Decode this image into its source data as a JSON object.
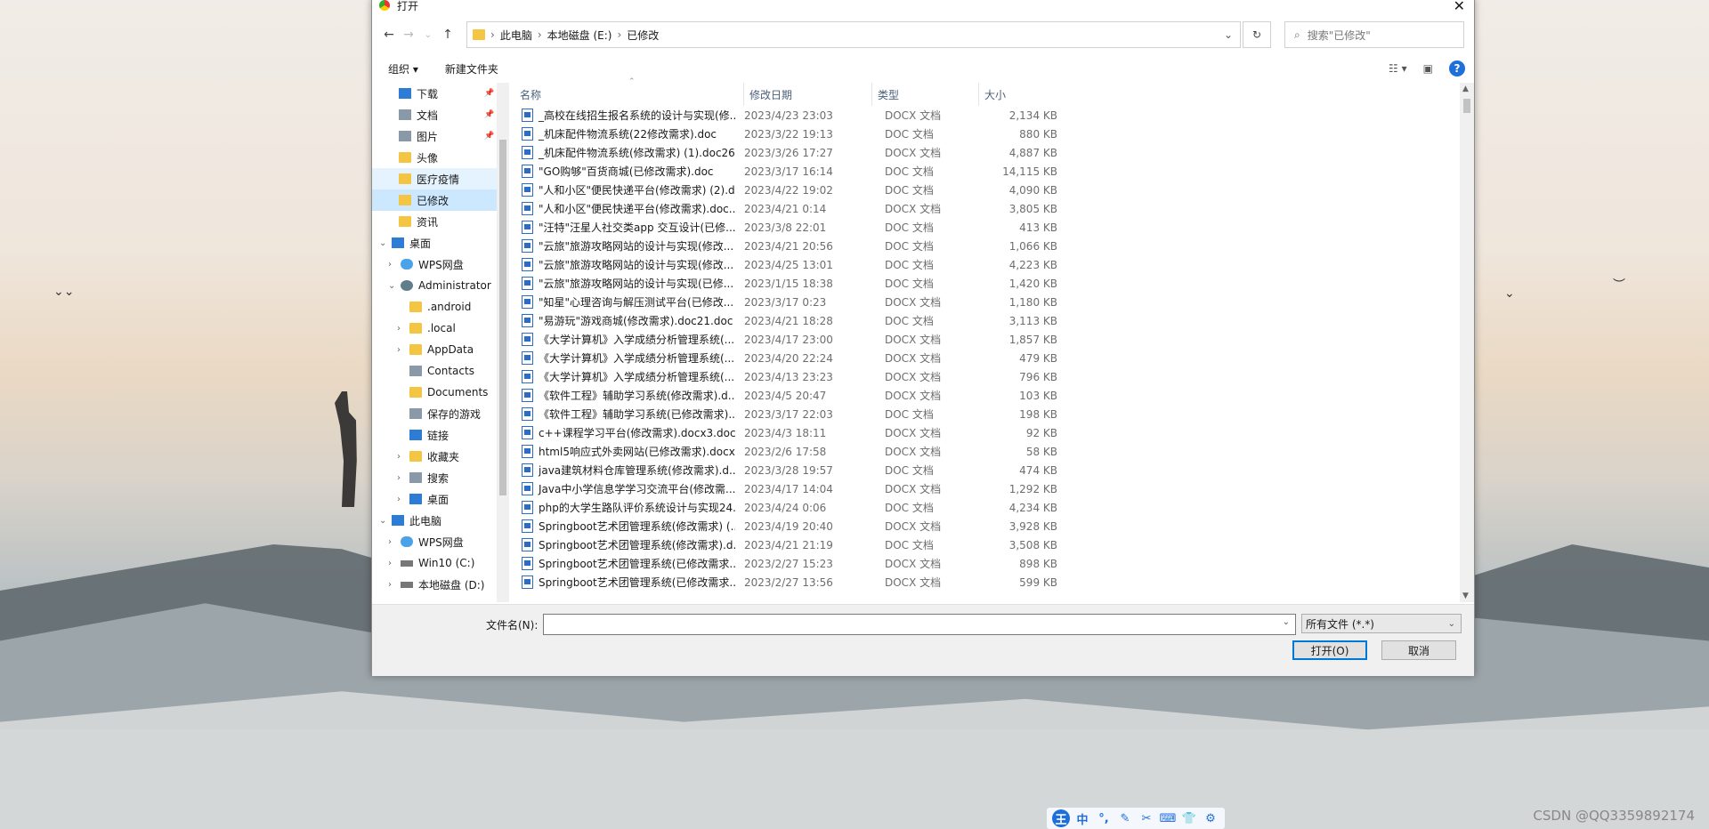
{
  "window": {
    "title": "打开"
  },
  "address": {
    "crumbs": [
      "此电脑",
      "本地磁盘 (E:)",
      "已修改"
    ],
    "search_placeholder": "搜索\"已修改\""
  },
  "toolbar": {
    "organize": "组织 ▾",
    "new_folder": "新建文件夹"
  },
  "nav": {
    "quick": [
      {
        "label": "下载",
        "icon": "download-icon",
        "pinned": true
      },
      {
        "label": "文档",
        "icon": "document-icon",
        "pinned": true
      },
      {
        "label": "图片",
        "icon": "picture-icon",
        "pinned": true
      },
      {
        "label": "头像",
        "icon": "folder-icon"
      },
      {
        "label": "医疗疫情",
        "icon": "folder-icon"
      },
      {
        "label": "已修改",
        "icon": "folder-icon"
      },
      {
        "label": "资讯",
        "icon": "folder-icon"
      }
    ],
    "desktop": "桌面",
    "wps_cloud": "WPS网盘",
    "admin": "Administrator",
    "admin_children": [
      ".android",
      ".local",
      "AppData",
      "Contacts",
      "Documents",
      "保存的游戏",
      "链接",
      "收藏夹",
      "搜索",
      "桌面"
    ],
    "this_pc": "此电脑",
    "pc_children": [
      "WPS网盘",
      "Win10 (C:)",
      "本地磁盘 (D:)"
    ]
  },
  "columns": {
    "name": "名称",
    "date": "修改日期",
    "type": "类型",
    "size": "大小"
  },
  "files": [
    {
      "name": "_高校在线招生报名系统的设计与实现(修...",
      "date": "2023/4/23 23:03",
      "type": "DOCX 文档",
      "size": "2,134 KB"
    },
    {
      "name": "_机床配件物流系统(22修改需求).doc",
      "date": "2023/3/22 19:13",
      "type": "DOC 文档",
      "size": "880 KB"
    },
    {
      "name": "_机床配件物流系统(修改需求) (1).doc26...",
      "date": "2023/3/26 17:27",
      "type": "DOCX 文档",
      "size": "4,887 KB"
    },
    {
      "name": "\"GO购够\"百货商城(已修改需求).doc",
      "date": "2023/3/17 16:14",
      "type": "DOC 文档",
      "size": "14,115 KB"
    },
    {
      "name": "\"人和小区\"便民快递平台(修改需求) (2).d...",
      "date": "2023/4/22 19:02",
      "type": "DOC 文档",
      "size": "4,090 KB"
    },
    {
      "name": "\"人和小区\"便民快递平台(修改需求).doc...",
      "date": "2023/4/21 0:14",
      "type": "DOCX 文档",
      "size": "3,805 KB"
    },
    {
      "name": "\"汪特\"汪星人社交类app 交互设计(已修...",
      "date": "2023/3/8 22:01",
      "type": "DOC 文档",
      "size": "413 KB"
    },
    {
      "name": "\"云旅\"旅游攻略网站的设计与实现(修改...",
      "date": "2023/4/21 20:56",
      "type": "DOC 文档",
      "size": "1,066 KB"
    },
    {
      "name": "\"云旅\"旅游攻略网站的设计与实现(修改...",
      "date": "2023/4/25 13:01",
      "type": "DOC 文档",
      "size": "4,223 KB"
    },
    {
      "name": "\"云旅\"旅游攻略网站的设计与实现(已修...",
      "date": "2023/1/15 18:38",
      "type": "DOC 文档",
      "size": "1,420 KB"
    },
    {
      "name": "\"知星\"心理咨询与解压测试平台(已修改...",
      "date": "2023/3/17 0:23",
      "type": "DOCX 文档",
      "size": "1,180 KB"
    },
    {
      "name": "\"易游玩\"游戏商城(修改需求).doc21.doc",
      "date": "2023/4/21 18:28",
      "type": "DOC 文档",
      "size": "3,113 KB"
    },
    {
      "name": "《大学计算机》入学成绩分析管理系统(...",
      "date": "2023/4/17 23:00",
      "type": "DOCX 文档",
      "size": "1,857 KB"
    },
    {
      "name": "《大学计算机》入学成绩分析管理系统(...",
      "date": "2023/4/20 22:24",
      "type": "DOCX 文档",
      "size": "479 KB"
    },
    {
      "name": "《大学计算机》入学成绩分析管理系统(...",
      "date": "2023/4/13 23:23",
      "type": "DOCX 文档",
      "size": "796 KB"
    },
    {
      "name": "《软件工程》辅助学习系统(修改需求).d...",
      "date": "2023/4/5 20:47",
      "type": "DOCX 文档",
      "size": "103 KB"
    },
    {
      "name": "《软件工程》辅助学习系统(已修改需求)....",
      "date": "2023/3/17 22:03",
      "type": "DOC 文档",
      "size": "198 KB"
    },
    {
      "name": "c++课程学习平台(修改需求).docx3.docx",
      "date": "2023/4/3 18:11",
      "type": "DOCX 文档",
      "size": "92 KB"
    },
    {
      "name": "html5响应式外卖网站(已修改需求).docx",
      "date": "2023/2/6 17:58",
      "type": "DOCX 文档",
      "size": "58 KB"
    },
    {
      "name": "java建筑材料仓库管理系统(修改需求).d...",
      "date": "2023/3/28 19:57",
      "type": "DOC 文档",
      "size": "474 KB"
    },
    {
      "name": "Java中小学信息学学习交流平台(修改需...",
      "date": "2023/4/17 14:04",
      "type": "DOCX 文档",
      "size": "1,292 KB"
    },
    {
      "name": "php的大学生路队评价系统设计与实现24...",
      "date": "2023/4/24 0:06",
      "type": "DOC 文档",
      "size": "4,234 KB"
    },
    {
      "name": "Springboot艺术团管理系统(修改需求) (...",
      "date": "2023/4/19 20:40",
      "type": "DOCX 文档",
      "size": "3,928 KB"
    },
    {
      "name": "Springboot艺术团管理系统(修改需求).d...",
      "date": "2023/4/21 21:19",
      "type": "DOC 文档",
      "size": "3,508 KB"
    },
    {
      "name": "Springboot艺术团管理系统(已修改需求...",
      "date": "2023/2/27 15:23",
      "type": "DOCX 文档",
      "size": "898 KB"
    },
    {
      "name": "Springboot艺术团管理系统(已修改需求...",
      "date": "2023/2/27 13:56",
      "type": "DOCX 文档",
      "size": "599 KB"
    }
  ],
  "bottom": {
    "filename_label": "文件名(N):",
    "filename_value": "",
    "filetype": "所有文件 (*.*)",
    "open": "打开(O)",
    "cancel": "取消"
  },
  "ime": [
    "王",
    "中",
    "°,",
    "✎",
    "✂",
    "⌨",
    "👕",
    "⚙"
  ],
  "watermark": "CSDN @QQ3359892174"
}
